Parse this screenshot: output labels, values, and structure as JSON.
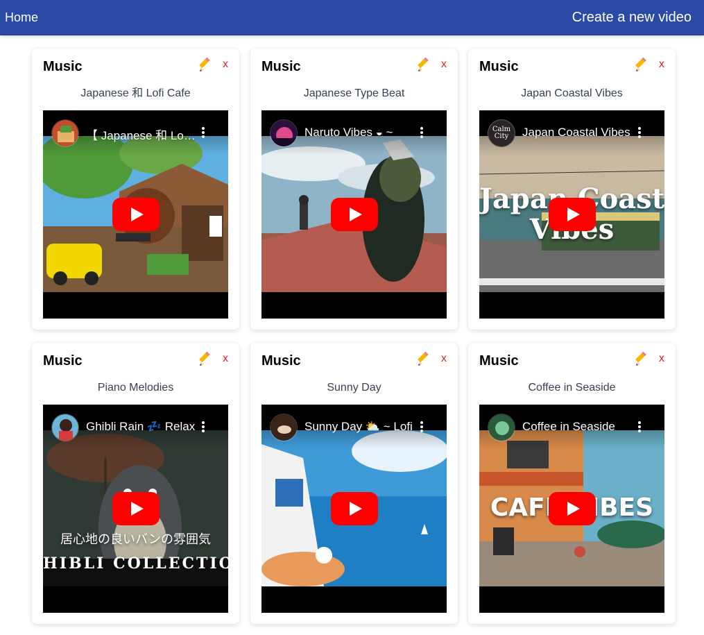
{
  "nav": {
    "home": "Home",
    "create": "Create a new video"
  },
  "colors": {
    "navbar": "#2a4aa6",
    "delete": "#e02424",
    "play": "#ff0000"
  },
  "icons": {
    "edit": "pencil-icon",
    "delete": "close-x",
    "play": "youtube-play-icon",
    "menu": "kebab-menu-icon"
  },
  "cards": [
    {
      "category": "Music",
      "delete_label": "x",
      "title": "Japanese 和 Lofi Cafe",
      "video_title": "【 Japanese 和 Lofi Cafe"
    },
    {
      "category": "Music",
      "delete_label": "x",
      "title": "Japanese Type Beat",
      "video_title": "Naruto Vibes ◒ ~"
    },
    {
      "category": "Music",
      "delete_label": "x",
      "title": "Japan Coastal Vibes",
      "video_title": "Japan Coastal Vibes",
      "overlay_line1": "Japan Coastal",
      "overlay_line2": "Vibes",
      "avatar_text": "Calm City"
    },
    {
      "category": "Music",
      "delete_label": "x",
      "title": "Piano Melodies",
      "video_title": "Ghibli Rain 💤 Relax",
      "overlay_line1": "居心地の良いバンの雰囲気",
      "overlay_line2": "HIBLI COLLECTIO"
    },
    {
      "category": "Music",
      "delete_label": "x",
      "title": "Sunny Day",
      "video_title": "Sunny Day ⛅ ~ Lofi"
    },
    {
      "category": "Music",
      "delete_label": "x",
      "title": "Coffee in Seaside",
      "video_title": "Coffee in Seaside",
      "overlay_line1": "CAFE VIBES"
    }
  ]
}
